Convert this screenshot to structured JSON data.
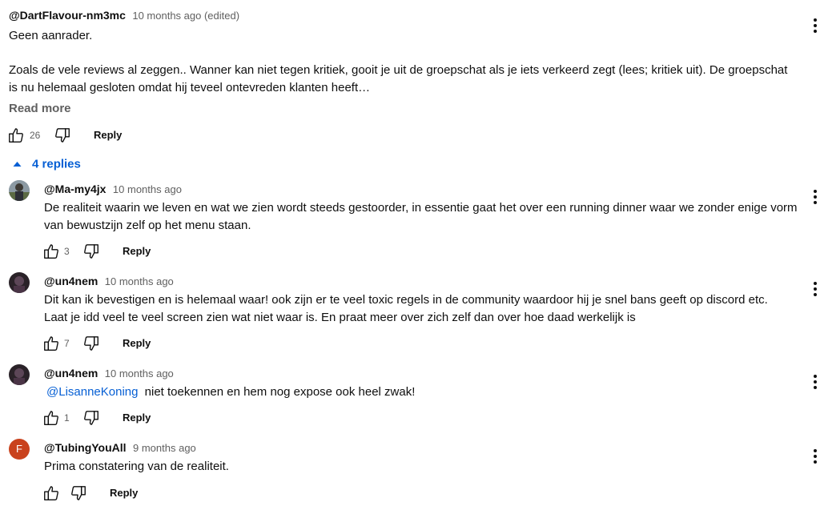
{
  "colors": {
    "link": "#065fd4",
    "muted": "#606060",
    "avatar_f": "#c9421d"
  },
  "top_comment": {
    "author": "@DartFlavour-nm3mc",
    "time": "10 months ago (edited)",
    "line1": "Geen aanrader.",
    "line2": "Zoals de vele reviews al zeggen.. Wanner kan niet tegen kritiek, gooit je uit de groepschat als je iets verkeerd zegt (lees; kritiek uit). De groepschat",
    "line3": "is nu helemaal gesloten omdat hij teveel ontevreden klanten heeft…",
    "read_more": "Read more",
    "likes": "26",
    "reply_label": "Reply"
  },
  "replies_toggle": {
    "label": "4 replies",
    "icon": "caret-up-icon"
  },
  "replies": [
    {
      "author": "@Ma-my4jx",
      "time": "10 months ago",
      "line1": "De realiteit waarin we leven en wat we zien wordt steeds gestoorder, in essentie gaat het over een running dinner waar we zonder enige vorm",
      "line2": "van bewustzijn zelf op het menu staan.",
      "likes": "3",
      "reply_label": "Reply"
    },
    {
      "author": "@un4nem",
      "time": "10 months ago",
      "line1": "Dit kan ik bevestigen en is helemaal waar! ook zijn er te veel toxic regels in de community waardoor hij je snel bans geeft op discord etc.",
      "line2": "Laat je idd veel te veel screen zien wat niet waar is. En praat meer over zich zelf dan over hoe daad werkelijk is",
      "likes": "7",
      "reply_label": "Reply"
    },
    {
      "author": "@un4nem",
      "time": "10 months ago",
      "mention": "@LisanneKoning",
      "line1": "niet toekennen en hem nog expose ook heel zwak!",
      "likes": "1",
      "reply_label": "Reply"
    },
    {
      "author": "@TubingYouAll",
      "time": "9 months ago",
      "avatar_letter": "F",
      "line1": "Prima constatering van de realiteit.",
      "reply_label": "Reply"
    }
  ]
}
